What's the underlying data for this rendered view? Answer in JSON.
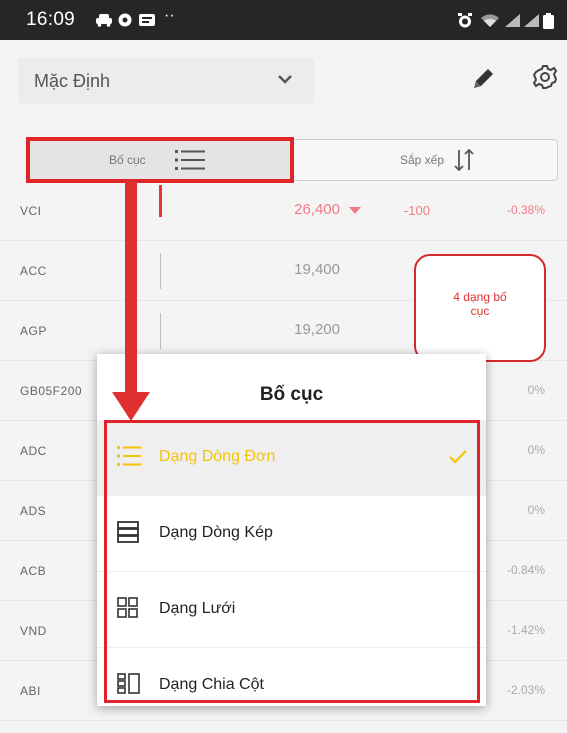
{
  "status_bar": {
    "time": "16:09",
    "more": "··"
  },
  "header": {
    "preset_value": "Mặc Định"
  },
  "segmented": {
    "layout_label": "Bố cục",
    "sort_label": "Sắp xếp"
  },
  "rows": [
    {
      "symbol": "VCI",
      "price": "26,400",
      "change": "-100",
      "percent": "-0.38%",
      "trend": "down"
    },
    {
      "symbol": "ACC",
      "price": "19,400",
      "change": "",
      "percent": "",
      "trend": "none"
    },
    {
      "symbol": "AGP",
      "price": "19,200",
      "change": "",
      "percent": "",
      "trend": "none"
    },
    {
      "symbol": "GB05F200",
      "price": "",
      "change": "",
      "percent": "0%",
      "trend": "none"
    },
    {
      "symbol": "ADC",
      "price": "",
      "change": "",
      "percent": "0%",
      "trend": "none"
    },
    {
      "symbol": "ADS",
      "price": "",
      "change": "",
      "percent": "0%",
      "trend": "none"
    },
    {
      "symbol": "ACB",
      "price": "",
      "change": "",
      "percent": "-0.84%",
      "trend": "none"
    },
    {
      "symbol": "VND",
      "price": "",
      "change": "",
      "percent": "-1.42%",
      "trend": "none"
    },
    {
      "symbol": "ABI",
      "price": "",
      "change": "",
      "percent": "-2.03%",
      "trend": "none"
    }
  ],
  "callout": {
    "line1": "4 dạng bố",
    "line2": "cục"
  },
  "sheet": {
    "title": "Bố cục",
    "options": [
      {
        "label": "Dạng Dòng Đơn",
        "icon": "single-line-list-icon",
        "selected": true
      },
      {
        "label": "Dạng Dòng Kép",
        "icon": "double-line-list-icon",
        "selected": false
      },
      {
        "label": "Dạng Lưới",
        "icon": "grid-icon",
        "selected": false
      },
      {
        "label": "Dạng Chia Cột",
        "icon": "split-column-icon",
        "selected": false
      }
    ]
  },
  "colors": {
    "accent_yellow": "#f6c400",
    "annotation_red": "#e0242a",
    "price_down": "#f07b85"
  }
}
